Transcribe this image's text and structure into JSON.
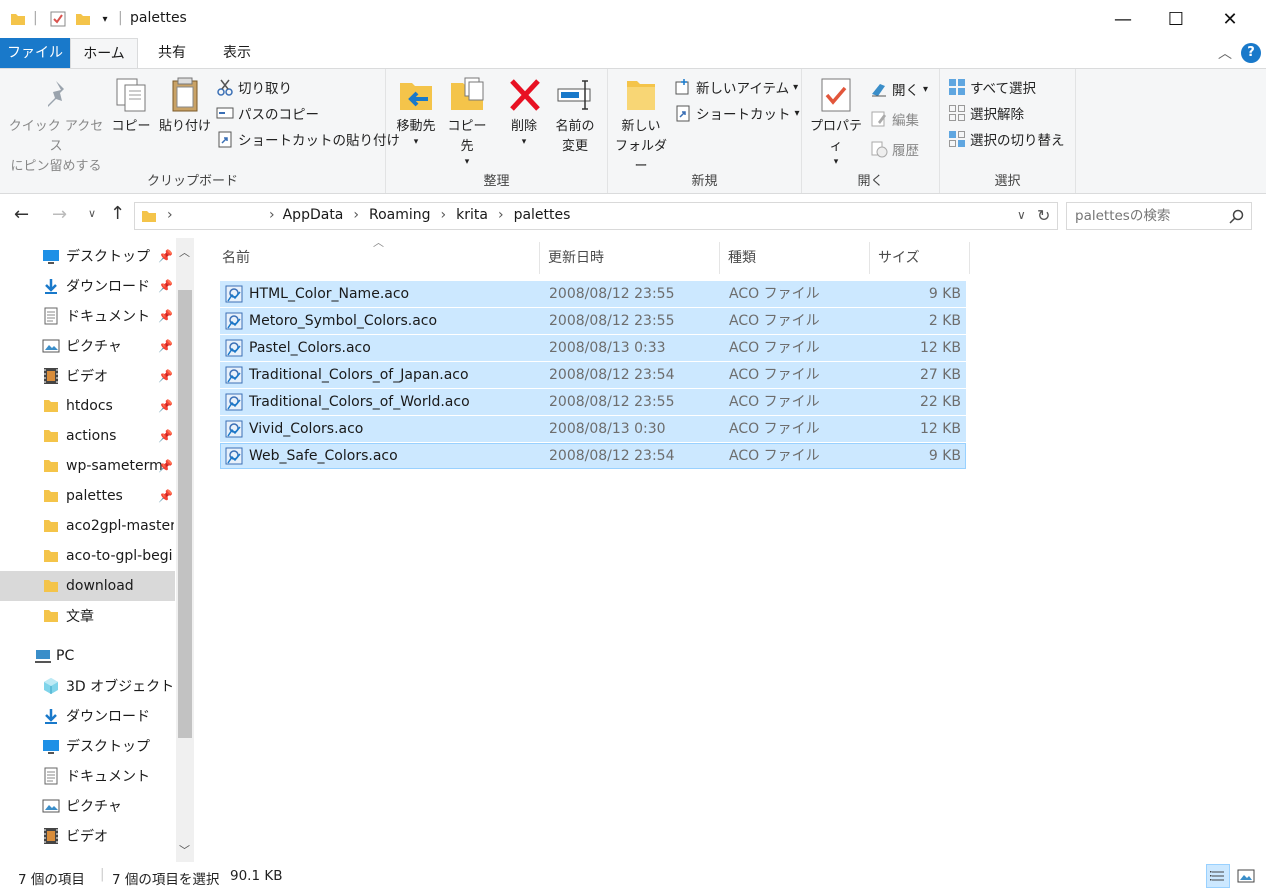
{
  "window": {
    "title": "palettes",
    "minimize": "—",
    "maximize": "☐",
    "close": "✕"
  },
  "tabs": [
    "ファイル",
    "ホーム",
    "共有",
    "表示"
  ],
  "ribbon": {
    "clipboard": {
      "label": "クリップボード",
      "pin_line1": "クイック アクセス",
      "pin_line2": "にピン留めする",
      "copy": "コピー",
      "paste": "貼り付け",
      "cut": "切り取り",
      "copy_path": "パスのコピー",
      "paste_shortcut": "ショートカットの貼り付け"
    },
    "organize": {
      "label": "整理",
      "move_to": "移動先",
      "copy_to": "コピー先",
      "delete": "削除",
      "rename_line1": "名前の",
      "rename_line2": "変更"
    },
    "new": {
      "label": "新規",
      "new_folder_line1": "新しい",
      "new_folder_line2": "フォルダー",
      "new_item": "新しいアイテム",
      "shortcut": "ショートカット"
    },
    "open": {
      "label": "開く",
      "properties": "プロパティ",
      "open": "開く",
      "edit": "編集",
      "history": "履歴"
    },
    "select": {
      "label": "選択",
      "select_all": "すべて選択",
      "select_none": "選択解除",
      "invert": "選択の切り替え"
    }
  },
  "address": {
    "path": [
      "AppData",
      "Roaming",
      "krita",
      "palettes"
    ],
    "search_placeholder": "palettesの検索"
  },
  "nav": {
    "quick_access": [
      {
        "label": "デスクトップ",
        "icon": "desktop-icon",
        "pinned": true
      },
      {
        "label": "ダウンロード",
        "icon": "download-icon",
        "pinned": true
      },
      {
        "label": "ドキュメント",
        "icon": "document-icon",
        "pinned": true
      },
      {
        "label": "ピクチャ",
        "icon": "picture-icon",
        "pinned": true
      },
      {
        "label": "ビデオ",
        "icon": "video-icon",
        "pinned": true
      },
      {
        "label": "htdocs",
        "icon": "folder-icon",
        "pinned": true
      },
      {
        "label": "actions",
        "icon": "folder-icon",
        "pinned": true
      },
      {
        "label": "wp-sameterm",
        "icon": "folder-icon",
        "pinned": true
      },
      {
        "label": "palettes",
        "icon": "folder-icon",
        "pinned": true
      },
      {
        "label": "aco2gpl-master",
        "icon": "folder-icon",
        "pinned": false
      },
      {
        "label": "aco-to-gpl-begi",
        "icon": "folder-icon",
        "pinned": false
      },
      {
        "label": "download",
        "icon": "folder-icon",
        "pinned": false,
        "selected": true
      },
      {
        "label": "文章",
        "icon": "folder-icon",
        "pinned": false
      }
    ],
    "pc": "PC",
    "pc_items": [
      {
        "label": "3D オブジェクト",
        "icon": "3d-objects-icon"
      },
      {
        "label": "ダウンロード",
        "icon": "download-icon"
      },
      {
        "label": "デスクトップ",
        "icon": "desktop-icon"
      },
      {
        "label": "ドキュメント",
        "icon": "document-icon"
      },
      {
        "label": "ピクチャ",
        "icon": "picture-icon"
      },
      {
        "label": "ビデオ",
        "icon": "video-icon"
      }
    ]
  },
  "columns": [
    "名前",
    "更新日時",
    "種類",
    "サイズ"
  ],
  "files": [
    {
      "name": "HTML_Color_Name.aco",
      "date": "2008/08/12 23:55",
      "type": "ACO ファイル",
      "size": "9 KB"
    },
    {
      "name": "Metoro_Symbol_Colors.aco",
      "date": "2008/08/12 23:55",
      "type": "ACO ファイル",
      "size": "2 KB"
    },
    {
      "name": "Pastel_Colors.aco",
      "date": "2008/08/13 0:33",
      "type": "ACO ファイル",
      "size": "12 KB"
    },
    {
      "name": "Traditional_Colors_of_Japan.aco",
      "date": "2008/08/12 23:54",
      "type": "ACO ファイル",
      "size": "27 KB"
    },
    {
      "name": "Traditional_Colors_of_World.aco",
      "date": "2008/08/12 23:55",
      "type": "ACO ファイル",
      "size": "22 KB"
    },
    {
      "name": "Vivid_Colors.aco",
      "date": "2008/08/13 0:30",
      "type": "ACO ファイル",
      "size": "12 KB"
    },
    {
      "name": "Web_Safe_Colors.aco",
      "date": "2008/08/12 23:54",
      "type": "ACO ファイル",
      "size": "9 KB"
    }
  ],
  "status": {
    "item_count": "7 個の項目",
    "selection": "7 個の項目を選択",
    "selection_size": "90.1 KB"
  },
  "colors": {
    "accent": "#1979ca",
    "selection": "#cce8ff",
    "selection_border": "#99d1ff",
    "folder": "#f4c44a",
    "delete": "#e81123"
  }
}
